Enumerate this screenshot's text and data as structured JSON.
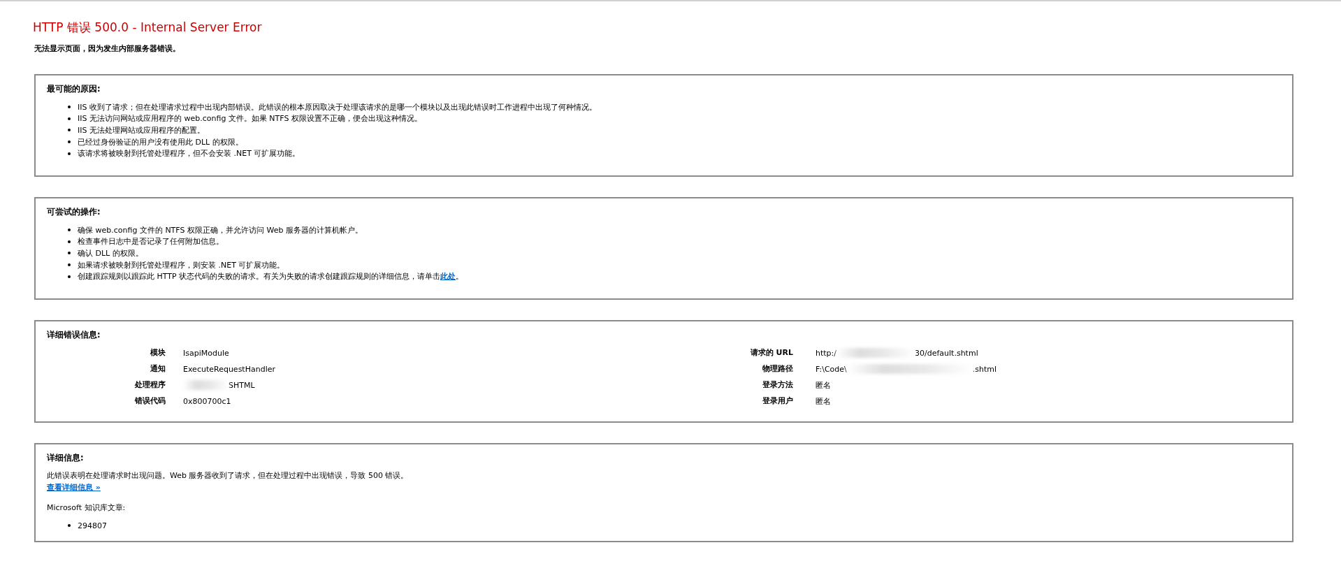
{
  "title": "HTTP 错误 500.0 - Internal Server Error",
  "subtitle": "无法显示页面，因为发生内部服务器错误。",
  "sections": [
    {
      "kind": "list",
      "heading": "最可能的原因:",
      "items": [
        "IIS 收到了请求；但在处理请求过程中出现内部错误。此错误的根本原因取决于处理该请求的是哪一个模块以及出现此错误时工作进程中出现了何种情况。",
        "IIS 无法访问网站或应用程序的 web.config 文件。如果 NTFS 权限设置不正确，便会出现这种情况。",
        "IIS 无法处理网站或应用程序的配置。",
        "已经过身份验证的用户没有使用此 DLL 的权限。",
        "该请求将被映射到托管处理程序，但不会安装 .NET 可扩展功能。"
      ]
    },
    {
      "kind": "list",
      "heading": "可尝试的操作:",
      "items": [
        "确保 web.config 文件的 NTFS 权限正确，并允许访问 Web 服务器的计算机帐户。",
        "检查事件日志中是否记录了任何附加信息。",
        "确认 DLL 的权限。",
        "如果请求被映射到托管处理程序，则安装 .NET 可扩展功能。",
        {
          "text": "创建跟踪规则以跟踪此 HTTP 状态代码的失败的请求。有关为失败的请求创建跟踪规则的详细信息，请单击",
          "link": "此处",
          "after": "。"
        }
      ]
    },
    {
      "kind": "details",
      "heading": "详细错误信息:",
      "columns": [
        [
          {
            "label": "模块",
            "value_end": "IsapiModule"
          },
          {
            "label": "通知",
            "value_end": "ExecuteRequestHandler"
          },
          {
            "label": "处理程序",
            "redacted": true,
            "value_end": "SHTML"
          },
          {
            "label": "错误代码",
            "value_end": "0x800700c1"
          }
        ],
        [
          {
            "label": "请求的 URL",
            "value_start": "http:/",
            "redacted": true,
            "value_end": "30/default.shtml"
          },
          {
            "label": "物理路径",
            "value_start": "F:\\Code\\",
            "redacted": true,
            "value_end": ".shtml",
            "wide": true
          },
          {
            "label": "登录方法",
            "value_end": "匿名"
          },
          {
            "label": "登录用户",
            "value_end": "匿名"
          }
        ]
      ]
    },
    {
      "kind": "info",
      "heading": "详细信息:",
      "text": "此错误表明在处理请求时出现问题。Web 服务器收到了请求，但在处理过程中出现错误，导致 500 错误。",
      "link": "查看详细信息 »",
      "kb_label": "Microsoft 知识库文章:",
      "kb_items": [
        "294807"
      ]
    }
  ]
}
